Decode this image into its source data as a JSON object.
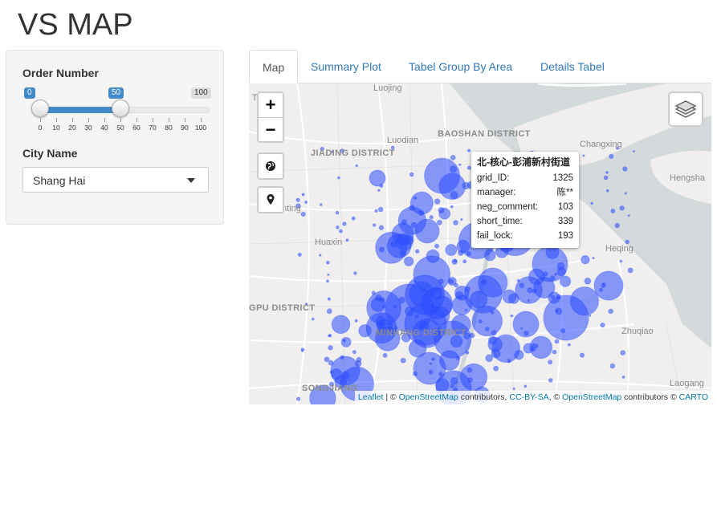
{
  "app": {
    "title": "VS MAP"
  },
  "sidebar": {
    "order_label": "Order Number",
    "slider": {
      "min": 0,
      "max": 100,
      "low": 0,
      "high": 50,
      "low_label": "0",
      "high_label": "50",
      "max_label": "100",
      "ticks": [
        "0",
        "10",
        "20",
        "30",
        "40",
        "50",
        "60",
        "70",
        "80",
        "90",
        "100"
      ]
    },
    "city_label": "City Name",
    "city_select": {
      "value": "Shang Hai"
    }
  },
  "tabs": [
    {
      "label": "Map",
      "active": true
    },
    {
      "label": "Summary Plot",
      "active": false
    },
    {
      "label": "Tabel Group By Area",
      "active": false
    },
    {
      "label": "Details Tabel",
      "active": false
    }
  ],
  "map": {
    "labels": {
      "luojing": "Luojing",
      "baoshan": "BAOSHAN DISTRICT",
      "changxing": "Changxing",
      "luodian": "Luodian",
      "jiading": "JIADING DISTRICT",
      "hengsha": "Hengsha",
      "anting": "nting",
      "huaxin": "Huaxin",
      "heqing": "Heqing",
      "gpu": "GPU DISTRICT",
      "zhuqiao": "Zhuqiao",
      "minhang": "MINHANG DISTRICT",
      "songjiang": "SONGJIANG",
      "laogang": "Laogang",
      "tang": "TANG"
    },
    "popup": {
      "title": "北-核心-彭浦新村街道",
      "rows": [
        {
          "key": "grid_ID:",
          "value": "1325"
        },
        {
          "key": "manager:",
          "value": "陈**"
        },
        {
          "key": "neg_comment:",
          "value": "103"
        },
        {
          "key": "short_time:",
          "value": "339"
        },
        {
          "key": "fail_lock:",
          "value": "193"
        }
      ]
    },
    "attribution": {
      "leaflet": "Leaflet",
      "sep1": " | © ",
      "osm1": "OpenStreetMap",
      "contrib1": " contributors, ",
      "ccbysa": "CC-BY-SA",
      "sep2": ", © ",
      "osm2": "OpenStreetMap",
      "contrib2": " contributors © ",
      "carto": "CARTO"
    },
    "colors": {
      "marker": "#2b4cff",
      "water": "#d4dadc",
      "land": "#f1efed",
      "road": "#ffffff"
    },
    "icons": {
      "zoom_in": "+",
      "zoom_out": "−",
      "globe": "globe-icon",
      "locate": "map-pin-icon",
      "layers": "layers-icon"
    }
  }
}
